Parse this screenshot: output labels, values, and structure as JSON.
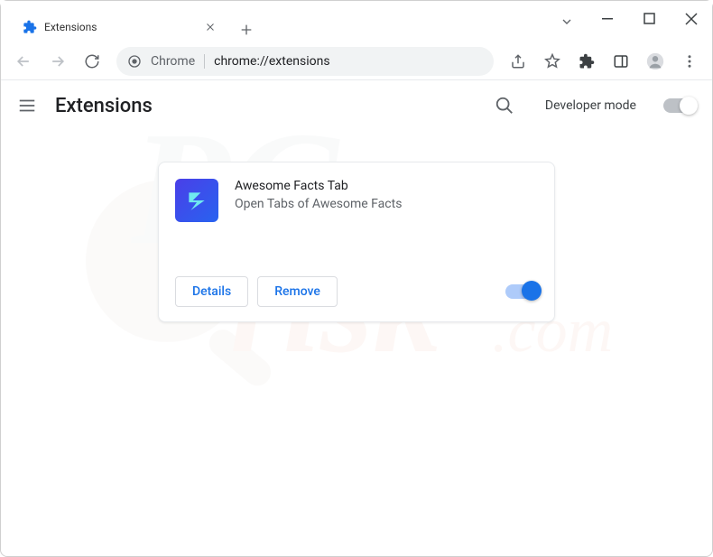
{
  "titlebar": {
    "tab_title": "Extensions"
  },
  "omnibox": {
    "scheme_label": "Chrome",
    "url": "chrome://extensions"
  },
  "ext_page": {
    "title": "Extensions",
    "devmode_label": "Developer mode"
  },
  "extension": {
    "name": "Awesome Facts Tab",
    "description": "Open Tabs of Awesome Facts",
    "details_label": "Details",
    "remove_label": "Remove"
  }
}
